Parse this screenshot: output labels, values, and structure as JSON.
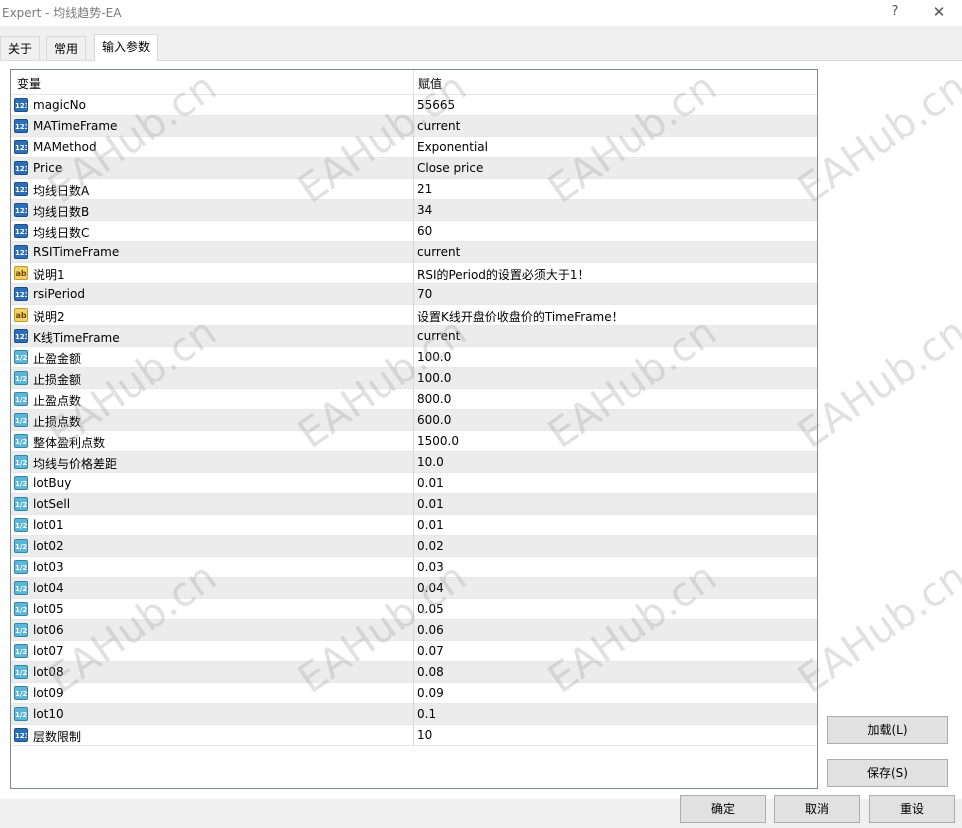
{
  "window": {
    "title": "Expert - 均线趋势-EA",
    "help_glyph": "?",
    "close_glyph": "✕"
  },
  "tabs": [
    {
      "label": "关于",
      "active": false
    },
    {
      "label": "常用",
      "active": false
    },
    {
      "label": "输入参数",
      "active": true
    }
  ],
  "grid": {
    "columns": {
      "variable": "变量",
      "value": "赋值"
    },
    "rows": [
      {
        "type": "int",
        "name": "magicNo",
        "value": "55665"
      },
      {
        "type": "int",
        "name": "MATimeFrame",
        "value": "current"
      },
      {
        "type": "int",
        "name": "MAMethod",
        "value": "Exponential"
      },
      {
        "type": "int",
        "name": "Price",
        "value": "Close price"
      },
      {
        "type": "int",
        "name": "均线日数A",
        "value": "21"
      },
      {
        "type": "int",
        "name": "均线日数B",
        "value": "34"
      },
      {
        "type": "int",
        "name": "均线日数C",
        "value": "60"
      },
      {
        "type": "int",
        "name": "RSITimeFrame",
        "value": "current"
      },
      {
        "type": "str",
        "name": "说明1",
        "value": "RSI的Period的设置必须大于1！"
      },
      {
        "type": "int",
        "name": "rsiPeriod",
        "value": "70"
      },
      {
        "type": "str",
        "name": "说明2",
        "value": "设置K线开盘价收盘价的TimeFrame！"
      },
      {
        "type": "int",
        "name": "K线TimeFrame",
        "value": "current"
      },
      {
        "type": "dbl",
        "name": "止盈金额",
        "value": "100.0"
      },
      {
        "type": "dbl",
        "name": "止损金额",
        "value": "100.0"
      },
      {
        "type": "dbl",
        "name": "止盈点数",
        "value": "800.0"
      },
      {
        "type": "dbl",
        "name": "止损点数",
        "value": "600.0"
      },
      {
        "type": "dbl",
        "name": "整体盈利点数",
        "value": "1500.0"
      },
      {
        "type": "dbl",
        "name": "均线与价格差距",
        "value": "10.0"
      },
      {
        "type": "dbl",
        "name": "lotBuy",
        "value": "0.01"
      },
      {
        "type": "dbl",
        "name": "lotSell",
        "value": "0.01"
      },
      {
        "type": "dbl",
        "name": "lot01",
        "value": "0.01"
      },
      {
        "type": "dbl",
        "name": "lot02",
        "value": "0.02"
      },
      {
        "type": "dbl",
        "name": "lot03",
        "value": "0.03"
      },
      {
        "type": "dbl",
        "name": "lot04",
        "value": "0.04"
      },
      {
        "type": "dbl",
        "name": "lot05",
        "value": "0.05"
      },
      {
        "type": "dbl",
        "name": "lot06",
        "value": "0.06"
      },
      {
        "type": "dbl",
        "name": "lot07",
        "value": "0.07"
      },
      {
        "type": "dbl",
        "name": "lot08",
        "value": "0.08"
      },
      {
        "type": "dbl",
        "name": "lot09",
        "value": "0.09"
      },
      {
        "type": "dbl",
        "name": "lot10",
        "value": "0.1"
      },
      {
        "type": "int",
        "name": "层数限制",
        "value": "10"
      }
    ]
  },
  "type_icons": {
    "int": "123",
    "str": "ab",
    "dbl": "1/2"
  },
  "buttons": {
    "load": "加载(L)",
    "save": "保存(S)",
    "ok": "确定",
    "cancel": "取消",
    "reset": "重设"
  },
  "watermark": "EAHub.cn"
}
